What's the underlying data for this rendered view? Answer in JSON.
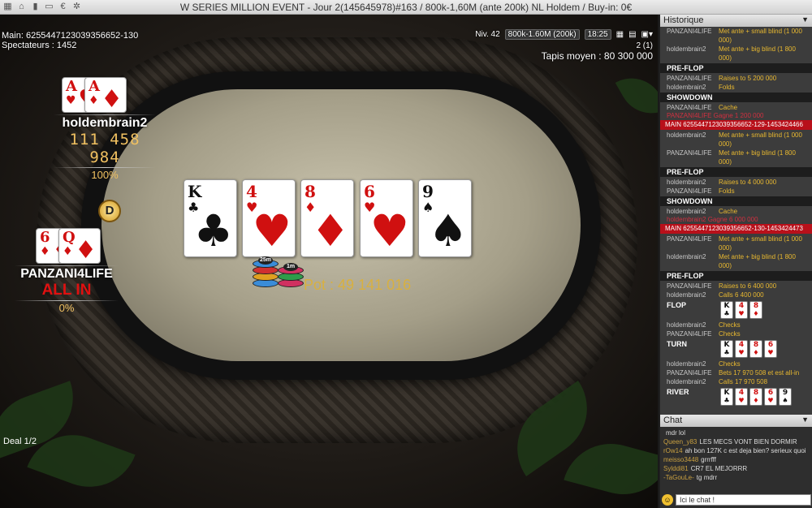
{
  "window": {
    "title": "W SERIES MILLION EVENT - Jour 2(145645978)#163 / 800k-1,60M (ante 200k) NL Holdem  / Buy-in: 0€"
  },
  "hud": {
    "main_id": "Main: 6255447123039356652-130",
    "spectators": "Spectateurs : 1452",
    "level": "Niv. 42",
    "blinds": "800k-1.60M (200k)",
    "clock": "18:25",
    "page": "2 (1)",
    "avg_stack": "Tapis moyen : 80 300 000"
  },
  "players": [
    {
      "name": "holdembrain2",
      "stack": "111 458 984",
      "percent": "100%",
      "cards": [
        {
          "rank": "A",
          "suit": "♥",
          "color": "red"
        },
        {
          "rank": "A",
          "suit": "♦",
          "color": "red"
        }
      ]
    },
    {
      "name": "PANZANI4LIFE",
      "status": "ALL IN",
      "percent": "0%",
      "cards": [
        {
          "rank": "6",
          "suit": "♦",
          "color": "red"
        },
        {
          "rank": "Q",
          "suit": "♦",
          "color": "red"
        }
      ]
    }
  ],
  "dealer": "D",
  "board": [
    {
      "rank": "K",
      "suit": "♣",
      "color": "blk"
    },
    {
      "rank": "4",
      "suit": "♥",
      "color": "red"
    },
    {
      "rank": "8",
      "suit": "♦",
      "color": "red"
    },
    {
      "rank": "6",
      "suit": "♥",
      "color": "red"
    },
    {
      "rank": "9",
      "suit": "♠",
      "color": "blk"
    }
  ],
  "chips": [
    "25m",
    "1m"
  ],
  "pot": "Pot : 49 141 016",
  "deal": "Deal 1/2",
  "history": {
    "title": "Historique",
    "entries": [
      {
        "t": "act",
        "n": "PANZANI4LIFE",
        "a": "Met ante + small blind (1 000"
      },
      {
        "t": "cont",
        "a": "000)"
      },
      {
        "t": "act",
        "n": "holdembrain2",
        "a": "Met ante + big blind (1 800"
      },
      {
        "t": "cont",
        "a": "000)"
      },
      {
        "t": "sec",
        "a": "PRE-FLOP"
      },
      {
        "t": "act",
        "n": "PANZANI4LIFE",
        "a": "Raises to 5 200 000"
      },
      {
        "t": "act",
        "n": "holdembrain2",
        "a": "Folds"
      },
      {
        "t": "sec",
        "a": "SHOWDOWN"
      },
      {
        "t": "act",
        "n": "PANZANI4LIFE",
        "a": "Cache"
      },
      {
        "t": "pink",
        "a": "PANZANI4LIFE Gagne 1 200 000"
      },
      {
        "t": "main",
        "a": "MAIN 6255447123039356652-129-1453424466"
      },
      {
        "t": "act",
        "n": "holdembrain2",
        "a": "Met ante + small blind (1 000"
      },
      {
        "t": "cont",
        "a": "000)"
      },
      {
        "t": "act",
        "n": "PANZANI4LIFE",
        "a": "Met ante + big blind (1 800"
      },
      {
        "t": "cont",
        "a": "000)"
      },
      {
        "t": "sec",
        "a": "PRE-FLOP"
      },
      {
        "t": "act",
        "n": "holdembrain2",
        "a": "Raises to 4 000 000"
      },
      {
        "t": "act",
        "n": "PANZANI4LIFE",
        "a": "Folds"
      },
      {
        "t": "sec",
        "a": "SHOWDOWN"
      },
      {
        "t": "act",
        "n": "holdembrain2",
        "a": "Cache"
      },
      {
        "t": "pink",
        "a": "holdembrain2 Gagne 6 000 000"
      },
      {
        "t": "main",
        "a": "MAIN 6255447123039356652-130-1453424473"
      },
      {
        "t": "act",
        "n": "PANZANI4LIFE",
        "a": "Met ante + small blind (1 000"
      },
      {
        "t": "cont",
        "a": "000)"
      },
      {
        "t": "act",
        "n": "holdembrain2",
        "a": "Met ante + big blind (1 800"
      },
      {
        "t": "cont",
        "a": "000)"
      },
      {
        "t": "sec",
        "a": "PRE-FLOP"
      },
      {
        "t": "act",
        "n": "PANZANI4LIFE",
        "a": "Raises to 6 400 000"
      },
      {
        "t": "act",
        "n": "holdembrain2",
        "a": "Calls 6 400 000"
      },
      {
        "t": "cards",
        "a": "FLOP",
        "c": [
          [
            "K",
            "♣",
            "blk"
          ],
          [
            "4",
            "♥",
            "red"
          ],
          [
            "8",
            "♦",
            "red"
          ]
        ]
      },
      {
        "t": "act",
        "n": "holdembrain2",
        "a": "Checks"
      },
      {
        "t": "act",
        "n": "PANZANI4LIFE",
        "a": "Checks"
      },
      {
        "t": "cards",
        "a": "TURN",
        "c": [
          [
            "K",
            "♣",
            "blk"
          ],
          [
            "4",
            "♥",
            "red"
          ],
          [
            "8",
            "♦",
            "red"
          ],
          [
            "6",
            "♥",
            "red"
          ]
        ]
      },
      {
        "t": "act",
        "n": "holdembrain2",
        "a": "Checks"
      },
      {
        "t": "act",
        "n": "PANZANI4LIFE",
        "a": "Bets 17 970 508 et est all-in"
      },
      {
        "t": "act",
        "n": "holdembrain2",
        "a": "Calls 17 970 508"
      },
      {
        "t": "cards",
        "a": "RIVER",
        "c": [
          [
            "K",
            "♣",
            "blk"
          ],
          [
            "4",
            "♥",
            "red"
          ],
          [
            "8",
            "♦",
            "red"
          ],
          [
            "6",
            "♥",
            "red"
          ],
          [
            "9",
            "♠",
            "blk"
          ]
        ]
      }
    ]
  },
  "chat": {
    "title": "Chat",
    "messages": [
      {
        "u": "",
        "m": "mdr lol"
      },
      {
        "u": "Queen_y83",
        "m": "LES MECS VONT BIEN DORMIR"
      },
      {
        "u": "rOw14",
        "m": "ah bon 127K c est deja bien? serieux quoi"
      },
      {
        "u": "meisso3448",
        "m": "grrrfff"
      },
      {
        "u": "Sylddi81",
        "m": "CR7 EL MEJORRR"
      },
      {
        "u": "-TaGouLe-",
        "m": "tg mdrr"
      }
    ],
    "input_placeholder": "Ici le chat !"
  }
}
